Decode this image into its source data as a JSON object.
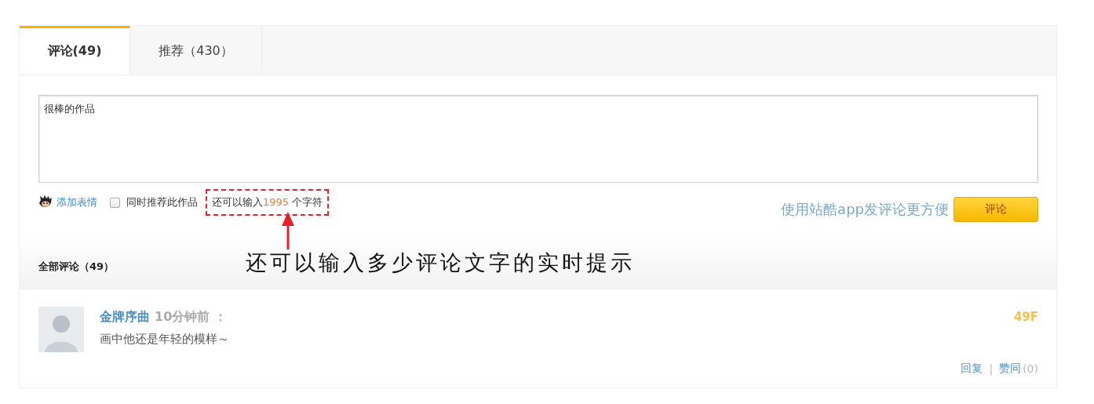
{
  "tabs": [
    {
      "label": "评论(49)",
      "selected": true
    },
    {
      "label": "推荐（430）",
      "selected": false
    }
  ],
  "editor": {
    "value": "很棒的作品"
  },
  "toolbar": {
    "emoji_link": "添加表情",
    "recommend": {
      "label": "同时推荐此作品",
      "checked": false
    },
    "counter": {
      "prefix": "还可以输入",
      "count": "1995",
      "suffix": " 个字符"
    },
    "app_hint": "使用站酷app发评论更方便",
    "submit": "评论"
  },
  "annotation": "还可以输入多少评论文字的实时提示",
  "all_comments": "全部评论（49）",
  "comments": [
    {
      "author": "金牌序曲",
      "time": "10分钟前 ：",
      "text": "画中他还是年轻的模样～",
      "floor": "49F",
      "reply": "回复",
      "separator": "|",
      "like": "赞同",
      "like_count": "(0)"
    }
  ]
}
